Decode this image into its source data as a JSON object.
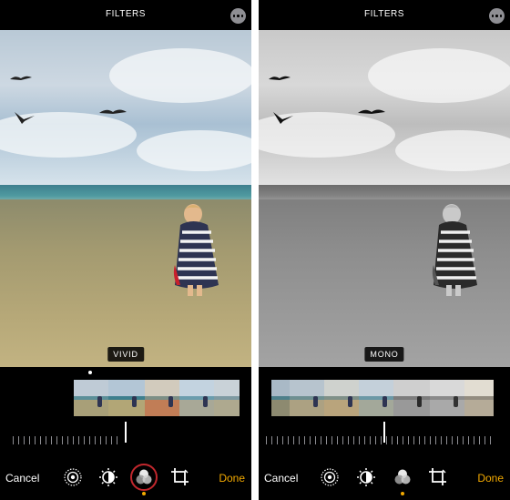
{
  "left_panel": {
    "header": {
      "title": "FILTERS",
      "more_icon": "more-ellipsis-icon"
    },
    "filter_name": "VIVID",
    "toolbar": {
      "cancel_label": "Cancel",
      "done_label": "Done",
      "tools": [
        "live-photo-icon",
        "adjust-icon",
        "filters-icon",
        "crop-icon"
      ],
      "active_tool": "filters-icon"
    }
  },
  "right_panel": {
    "header": {
      "title": "FILTERS",
      "more_icon": "more-ellipsis-icon"
    },
    "filter_name": "MONO",
    "toolbar": {
      "cancel_label": "Cancel",
      "done_label": "Done",
      "tools": [
        "live-photo-icon",
        "adjust-icon",
        "filters-icon",
        "crop-icon"
      ],
      "active_tool": "filters-icon"
    }
  },
  "colors": {
    "accent": "#f2a900",
    "active_ring": "#c1272d",
    "background": "#000000"
  }
}
